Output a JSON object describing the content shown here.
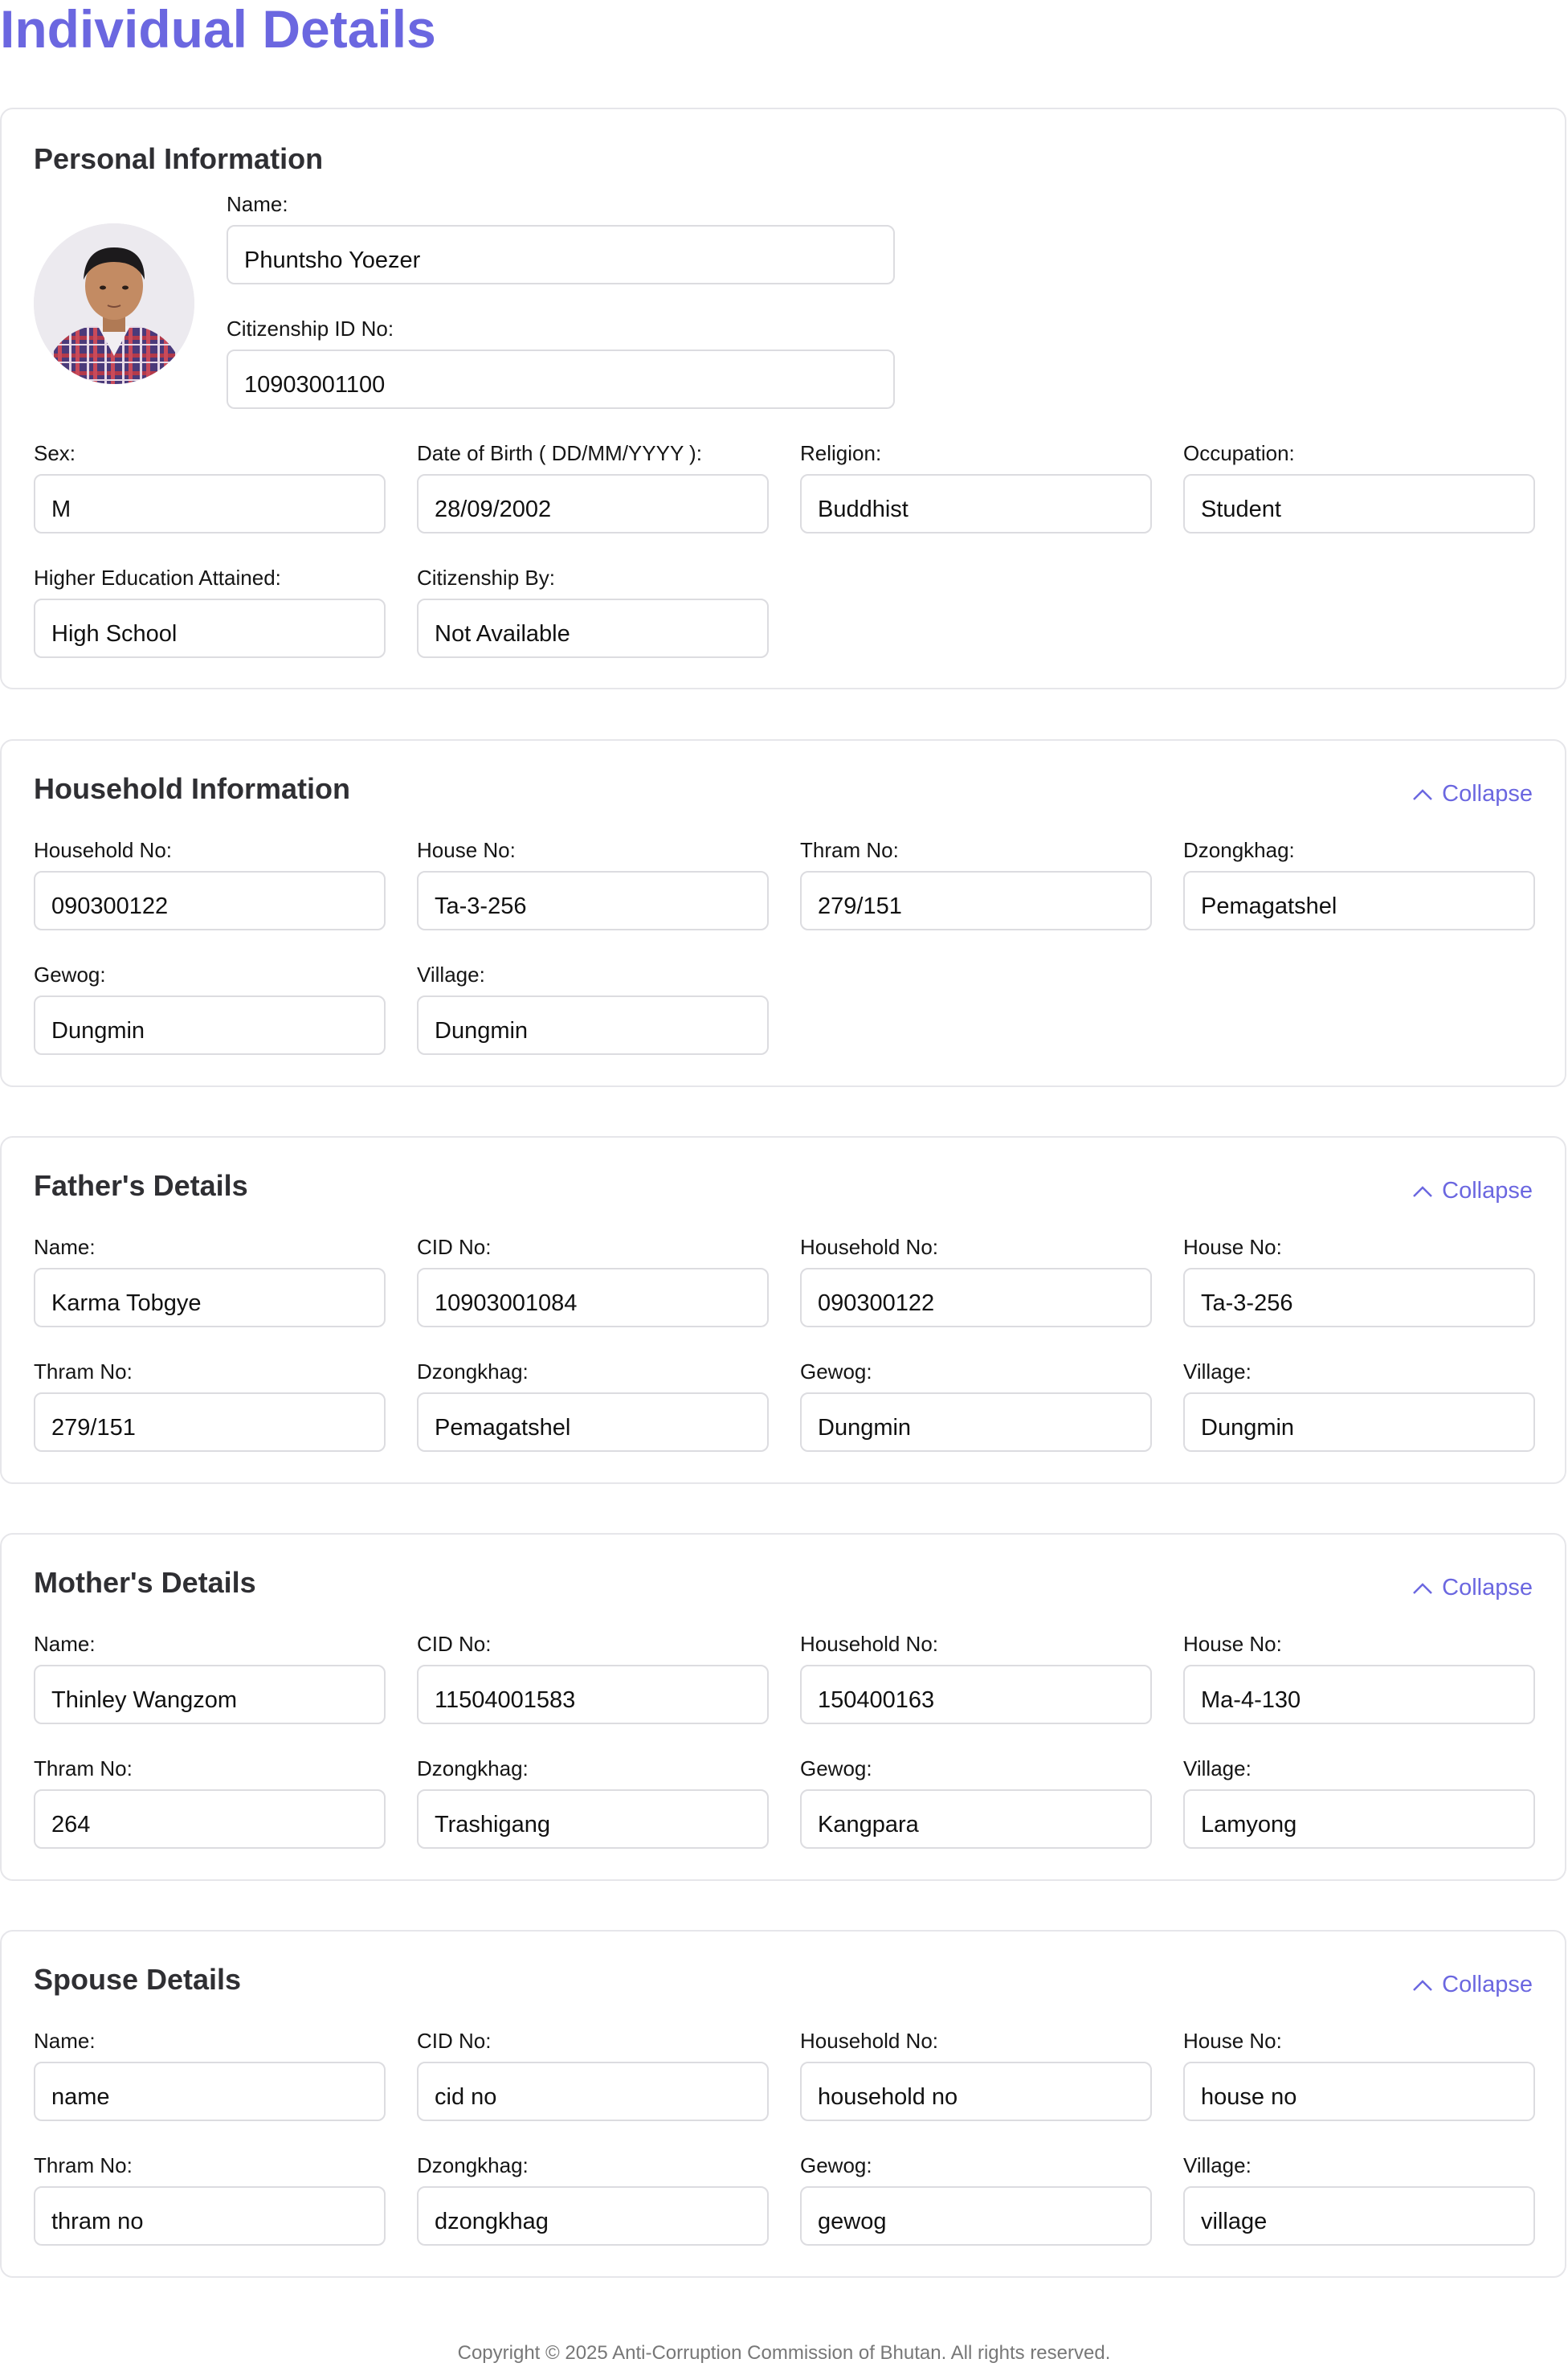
{
  "page": {
    "title": "Individual Details"
  },
  "personal": {
    "title": "Personal Information",
    "name": {
      "label": "Name:",
      "value": "Phuntsho Yoezer"
    },
    "cid": {
      "label": "Citizenship ID No:",
      "value": "10903001100"
    },
    "sex": {
      "label": "Sex:",
      "value": "M"
    },
    "dob": {
      "label": "Date of Birth ( DD/MM/YYYY ):",
      "value": "28/09/2002"
    },
    "religion": {
      "label": "Religion:",
      "value": "Buddhist"
    },
    "occupation": {
      "label": "Occupation:",
      "value": "Student"
    },
    "education": {
      "label": "Higher Education Attained:",
      "value": "High School"
    },
    "citizenship_by": {
      "label": "Citizenship By:",
      "value": "Not Available"
    }
  },
  "household": {
    "title": "Household Information",
    "collapse_label": "Collapse",
    "household_no": {
      "label": "Household No:",
      "value": "090300122"
    },
    "house_no": {
      "label": "House No:",
      "value": "Ta-3-256"
    },
    "thram_no": {
      "label": "Thram No:",
      "value": "279/151"
    },
    "dzongkhag": {
      "label": "Dzongkhag:",
      "value": "Pemagatshel"
    },
    "gewog": {
      "label": "Gewog:",
      "value": "Dungmin"
    },
    "village": {
      "label": "Village:",
      "value": "Dungmin"
    }
  },
  "father": {
    "title": "Father's Details",
    "collapse_label": "Collapse",
    "name": {
      "label": "Name:",
      "value": "Karma Tobgye"
    },
    "cid": {
      "label": "CID No:",
      "value": "10903001084"
    },
    "household_no": {
      "label": "Household No:",
      "value": "090300122"
    },
    "house_no": {
      "label": "House No:",
      "value": "Ta-3-256"
    },
    "thram_no": {
      "label": "Thram No:",
      "value": "279/151"
    },
    "dzongkhag": {
      "label": "Dzongkhag:",
      "value": "Pemagatshel"
    },
    "gewog": {
      "label": "Gewog:",
      "value": "Dungmin"
    },
    "village": {
      "label": "Village:",
      "value": "Dungmin"
    }
  },
  "mother": {
    "title": "Mother's Details",
    "collapse_label": "Collapse",
    "name": {
      "label": "Name:",
      "value": "Thinley Wangzom"
    },
    "cid": {
      "label": "CID No:",
      "value": "11504001583"
    },
    "household_no": {
      "label": "Household No:",
      "value": "150400163"
    },
    "house_no": {
      "label": "House No:",
      "value": "Ma-4-130"
    },
    "thram_no": {
      "label": "Thram No:",
      "value": "264"
    },
    "dzongkhag": {
      "label": "Dzongkhag:",
      "value": "Trashigang"
    },
    "gewog": {
      "label": "Gewog:",
      "value": "Kangpara"
    },
    "village": {
      "label": "Village:",
      "value": "Lamyong"
    }
  },
  "spouse": {
    "title": "Spouse Details",
    "collapse_label": "Collapse",
    "name": {
      "label": "Name:",
      "placeholder": "name"
    },
    "cid": {
      "label": "CID No:",
      "placeholder": "cid no"
    },
    "household_no": {
      "label": "Household No:",
      "placeholder": "household no"
    },
    "house_no": {
      "label": "House No:",
      "placeholder": "house no"
    },
    "thram_no": {
      "label": "Thram No:",
      "placeholder": "thram no"
    },
    "dzongkhag": {
      "label": "Dzongkhag:",
      "placeholder": "dzongkhag"
    },
    "gewog": {
      "label": "Gewog:",
      "placeholder": "gewog"
    },
    "village": {
      "label": "Village:",
      "placeholder": "village"
    }
  },
  "icons": {
    "collapse": "chevron-up-icon",
    "avatar": "user-photo"
  },
  "colors": {
    "accent": "#6b67e0",
    "border": "#e6e6ea"
  },
  "footer": {
    "text": "Copyright © 2025 Anti-Corruption Commission of Bhutan. All rights reserved."
  }
}
